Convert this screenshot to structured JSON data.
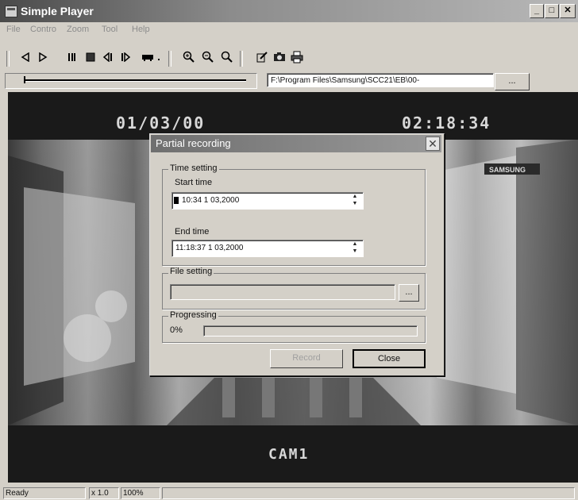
{
  "window": {
    "title": "Simple Player"
  },
  "menu": [
    "File",
    "Contro",
    "Zoom",
    "Tool",
    "Help"
  ],
  "toolbar": {
    "path_value": "F:\\Program Files\\Samsung\\SCC21\\EB\\00-",
    "browse_label": "..."
  },
  "video": {
    "date": "01/03/00",
    "time": "02:18:34",
    "camera": "CAM1"
  },
  "dialog": {
    "title": "Partial recording",
    "time_setting": "Time setting",
    "start_label": "Start time",
    "start_value": "10:34 1 03,2000",
    "end_label": "End time",
    "end_value": "11:18:37 1 03,2000",
    "file_setting": "File setting",
    "file_browse": "...",
    "progressing": "Progressing",
    "progress_text": "0%",
    "progress": 0,
    "record": "Record",
    "close": "Close"
  },
  "status": {
    "ready": "Ready",
    "speed": "x 1.0",
    "zoom": "100%"
  }
}
